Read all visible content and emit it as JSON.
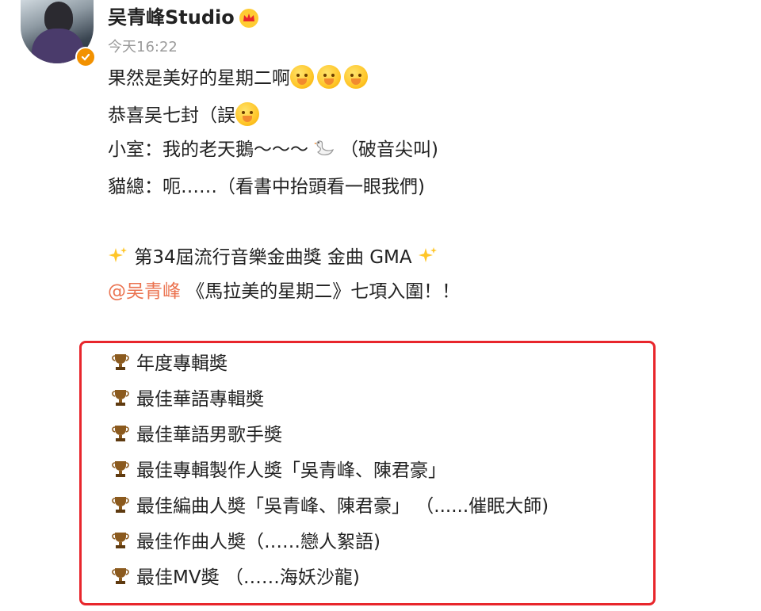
{
  "post": {
    "author": "吴青峰Studio",
    "time": "今天16:22",
    "lines": {
      "l1": "果然是美好的星期二啊",
      "l2": "恭喜吴七封（誤",
      "l3a": "小室：我的老天鵝～～～",
      "l3b": "（破音尖叫)",
      "l4": "貓總：呃……（看書中抬頭看一眼我們)",
      "l5": "第34屆流行音樂金曲獎 金曲 GMA",
      "l6_mention": "@吴青峰",
      "l6_rest": " 《馬拉美的星期二》七項入圍！！"
    },
    "awards": [
      "年度專輯奬",
      "最佳華語專輯奬",
      "最佳華語男歌手奬",
      "最佳專輯製作人奬「吳青峰、陳君豪」",
      "最佳編曲人奬「吳青峰、陳君豪」 （......催眠大師)",
      "最佳作曲人奬（……戀人絮語)",
      "最佳MV奬 （……海妖沙龍)"
    ]
  },
  "icons": {
    "verified": "verified-badge-icon",
    "crown": "crown-icon",
    "emoji": "shushing-face-emoji",
    "swan": "swan-icon",
    "sparkle": "sparkles-icon",
    "trophy": "trophy-icon"
  },
  "colors": {
    "mention": "#eb7350",
    "highlight_border": "#e8262c",
    "timestamp": "#9a9a9a"
  }
}
